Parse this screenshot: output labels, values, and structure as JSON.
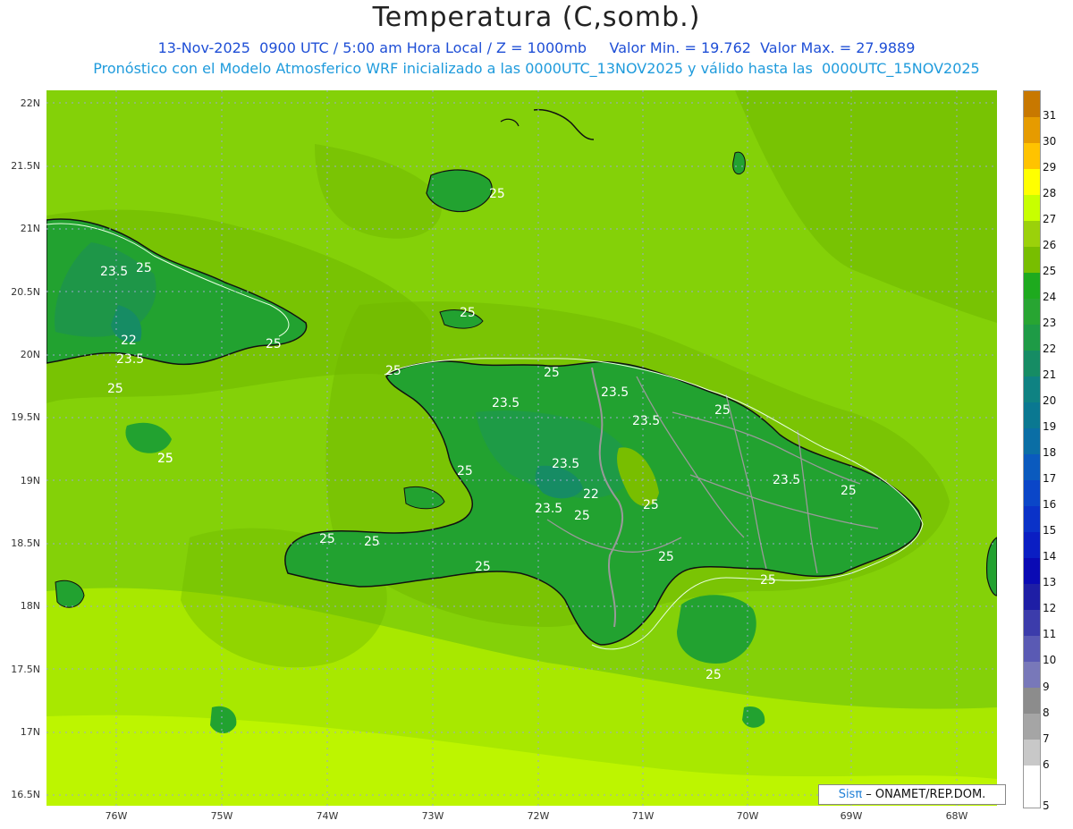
{
  "header": {
    "title": "Temperatura (C,somb.)",
    "subtitle_line1": "13-Nov-2025  0900 UTC / 5:00 am Hora Local / Z = 1000mb     Valor Min. = 19.762  Valor Max. = 27.9889",
    "subtitle_line2": "Pronóstico con el Modelo Atmosferico WRF inicializado a las 0000UTC_13NOV2025 y válido hasta las  0000UTC_15NOV2025"
  },
  "axes": {
    "lat_labels": [
      "22N",
      "21.5N",
      "21N",
      "20.5N",
      "20N",
      "19.5N",
      "19N",
      "18.5N",
      "18N",
      "17.5N",
      "17N",
      "16.5N"
    ],
    "lon_labels": [
      "76W",
      "75W",
      "74W",
      "73W",
      "72W",
      "71W",
      "70W",
      "69W",
      "68W"
    ]
  },
  "contour_labels": [
    "23.5",
    "25",
    "25",
    "22",
    "23.5",
    "25",
    "25",
    "25",
    "25",
    "25",
    "23.5",
    "23.5",
    "23.5",
    "25",
    "25",
    "23.5",
    "22",
    "23.5",
    "25",
    "25",
    "25",
    "23.5",
    "25",
    "25",
    "25",
    "25",
    "25",
    "25",
    "25",
    "25"
  ],
  "legend": {
    "labels": [
      "31",
      "30",
      "29",
      "28",
      "27",
      "26",
      "25",
      "24",
      "23",
      "22",
      "21",
      "20",
      "19",
      "18",
      "17",
      "16",
      "15",
      "14",
      "13",
      "12",
      "11",
      "10",
      "9",
      "8",
      "7",
      "6",
      "5"
    ],
    "colors": [
      "#c87800",
      "#e69b00",
      "#ffc300",
      "#ffff00",
      "#c8ff00",
      "#9bd10a",
      "#78be00",
      "#1eaa1e",
      "#28a532",
      "#1e9b46",
      "#168c64",
      "#0f8282",
      "#0a7891",
      "#0a6ea5",
      "#0a5abe",
      "#0a46c8",
      "#0a32c8",
      "#0a1ec3",
      "#0a0ab4",
      "#1e1ea5",
      "#3c3cab",
      "#5a5ab4",
      "#7878b9",
      "#8c8c8c",
      "#a5a5a5",
      "#c8c8c8",
      "#ffffff"
    ]
  },
  "credit": {
    "sis": "Sisπ",
    "text": " – ONAMET/REP.DOM."
  }
}
